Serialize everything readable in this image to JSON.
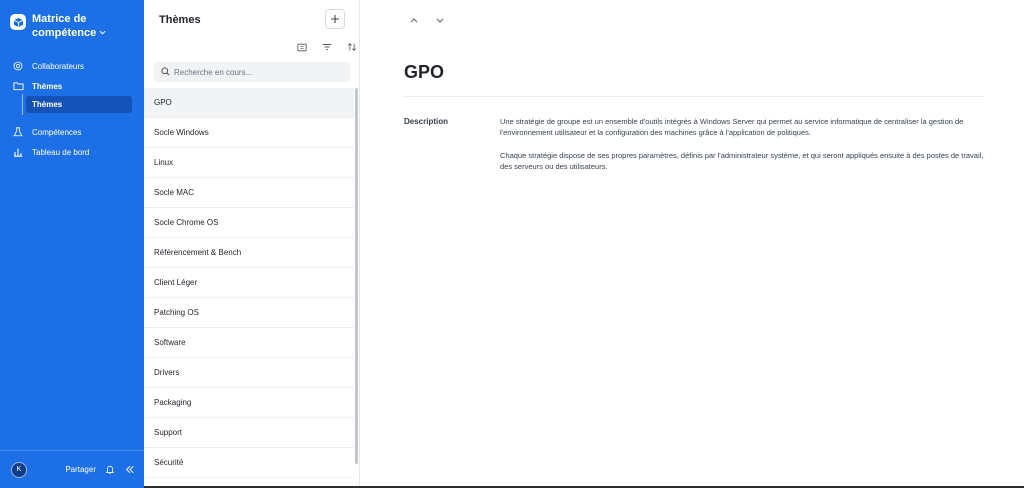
{
  "sidebar": {
    "app_title": "Matrice de compétence",
    "nav": [
      {
        "label": "Collaborateurs",
        "icon": "at-sign-icon"
      },
      {
        "label": "Thèmes",
        "icon": "folder-icon"
      },
      {
        "label": "Thèmes",
        "icon": ""
      },
      {
        "label": "Compétences",
        "icon": "flask-icon"
      },
      {
        "label": "Tableau de bord",
        "icon": "dashboard-icon"
      }
    ],
    "footer": {
      "avatar_initial": "K",
      "share_label": "Partager"
    }
  },
  "panel": {
    "title": "Thèmes",
    "search_placeholder": "Recherche en cours...",
    "items": [
      {
        "label": "GPO",
        "active": true
      },
      {
        "label": "Socle Windows"
      },
      {
        "label": "Linux"
      },
      {
        "label": "Socle MAC"
      },
      {
        "label": "Socle Chrome OS"
      },
      {
        "label": "Référencement & Bench"
      },
      {
        "label": "Client Léger"
      },
      {
        "label": "Patching OS"
      },
      {
        "label": "Software"
      },
      {
        "label": "Drivers"
      },
      {
        "label": "Packaging"
      },
      {
        "label": "Support"
      },
      {
        "label": "Sécurité"
      }
    ]
  },
  "detail": {
    "title": "GPO",
    "description_label": "Description",
    "description_p1": "Une stratégie de groupe est un ensemble d'outils intégrés à Windows Server qui permet au service informatique de centraliser la gestion de l'environnement utilisateur et la configuration des machines grâce à l'application de politiques.",
    "description_p2": "Chaque stratégie dispose de ses propres paramètres, définis par l'administrateur système, et qui seront appliqués ensuite à des postes de travail, des serveurs ou des utilisateurs."
  },
  "colors": {
    "sidebar_bg": "#1d6fe6",
    "sidebar_active": "#1452b8"
  }
}
